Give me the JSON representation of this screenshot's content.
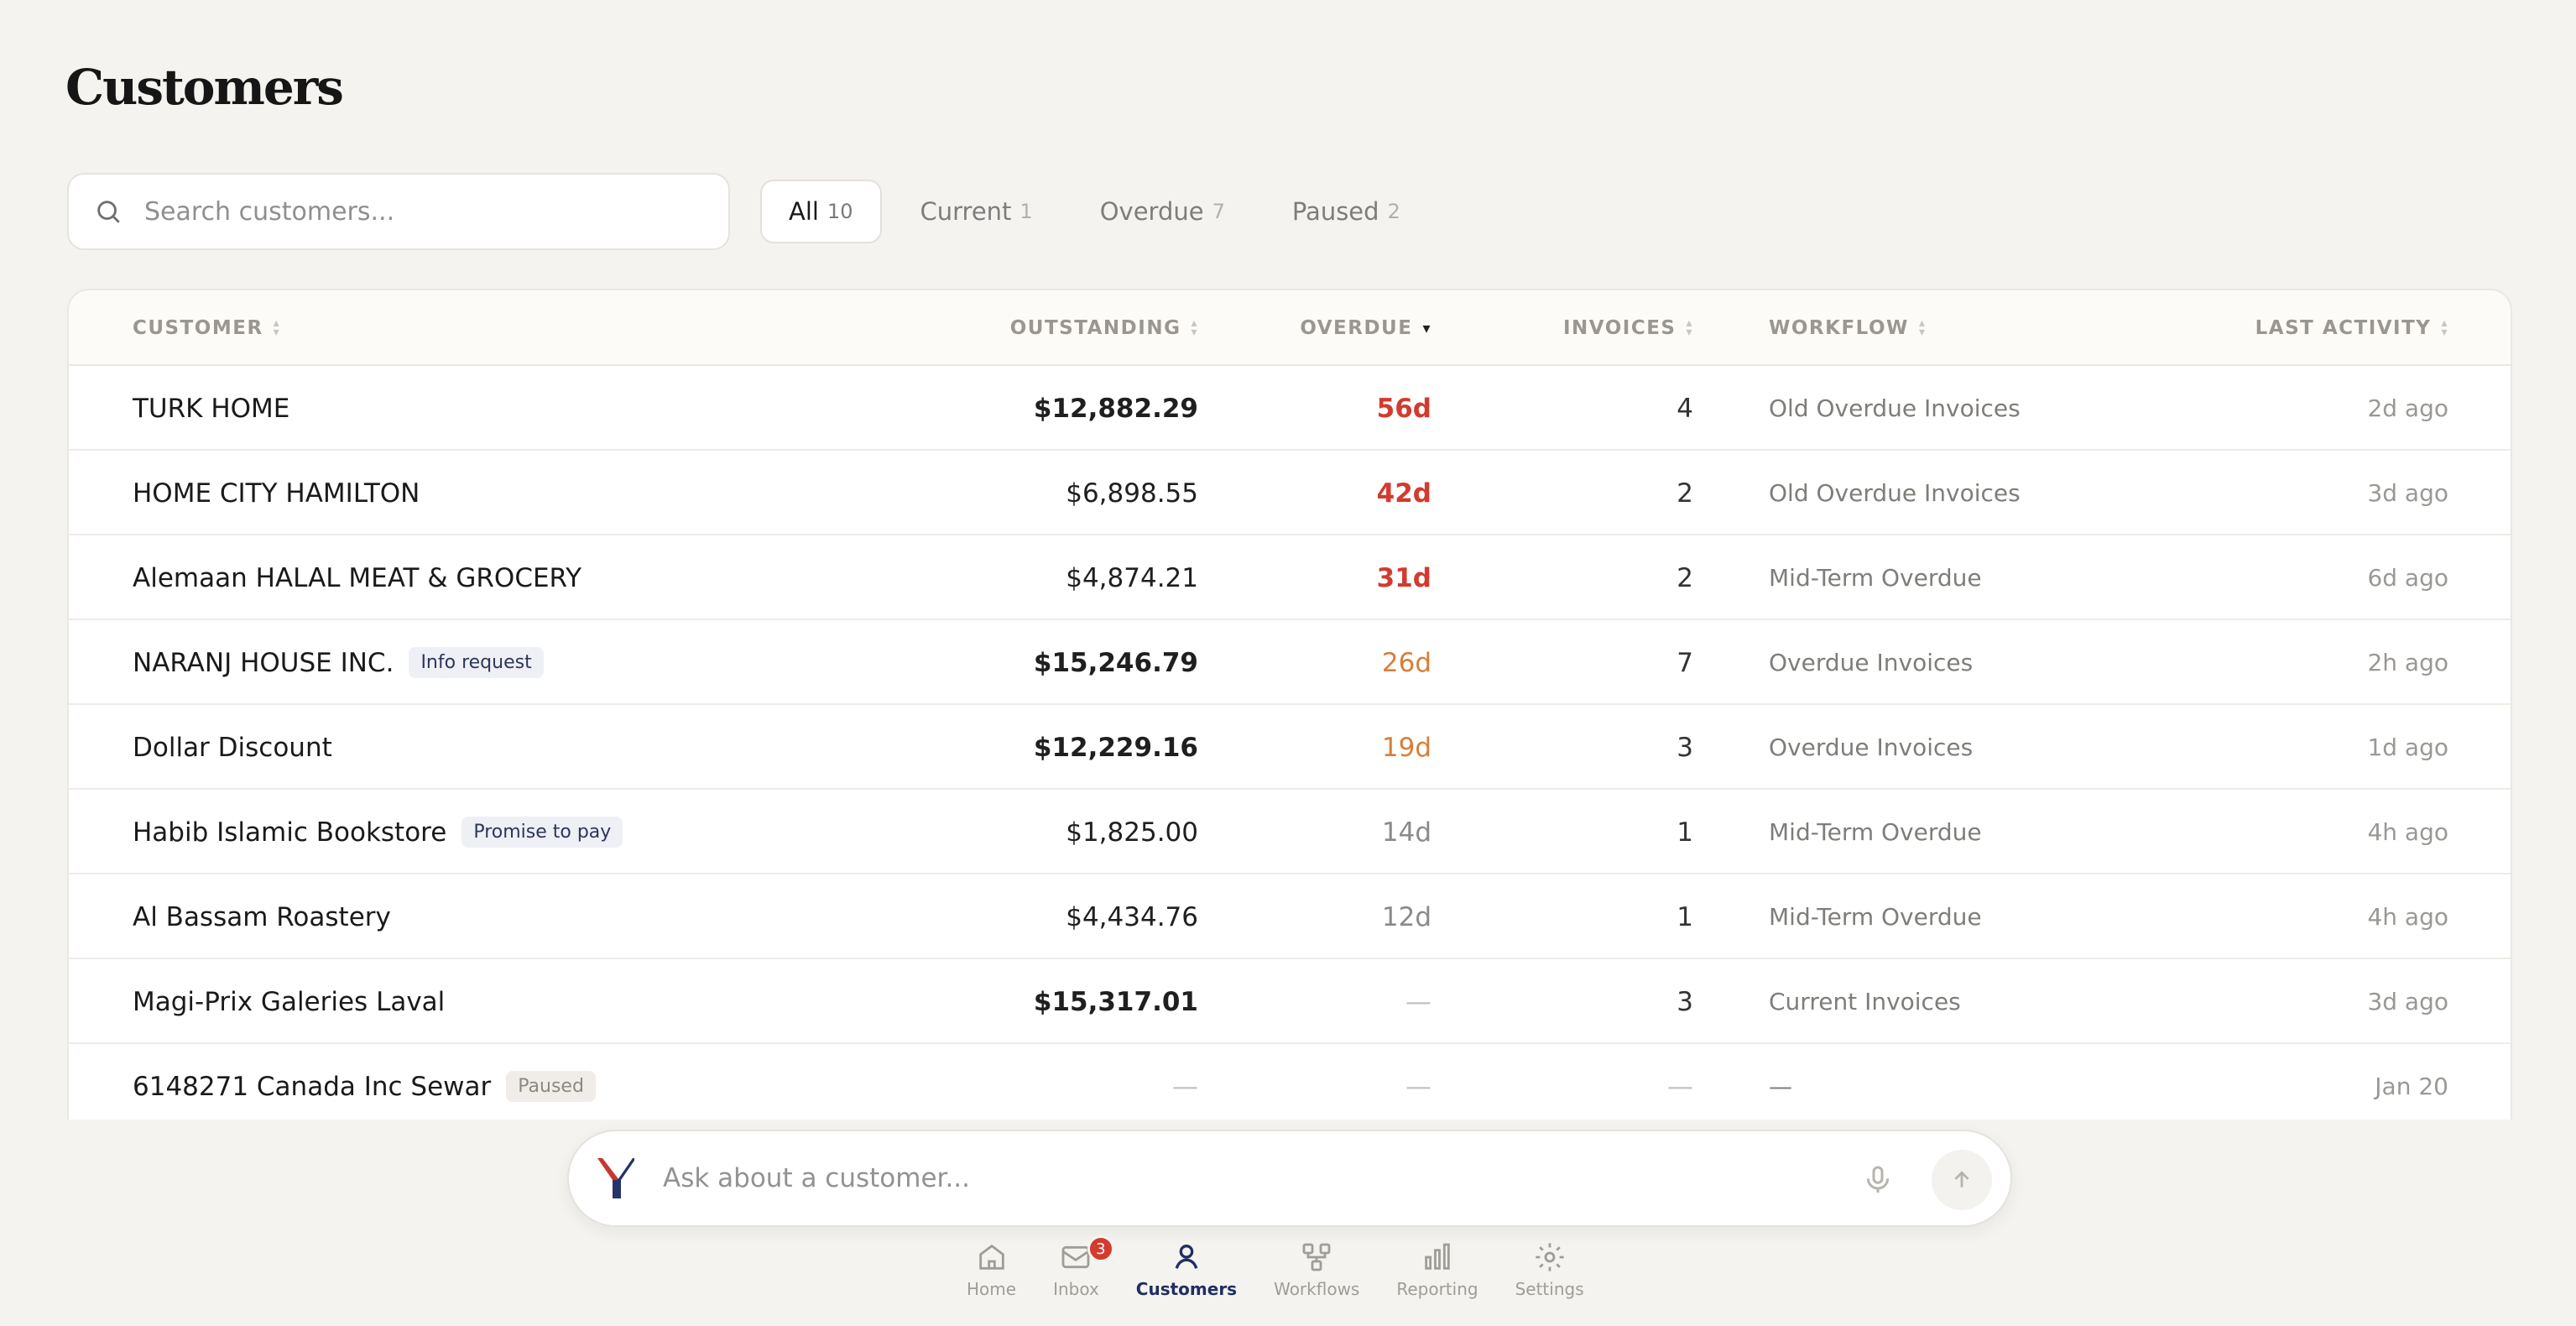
{
  "page": {
    "title": "Customers"
  },
  "search": {
    "placeholder": "Search customers..."
  },
  "filters": [
    {
      "label": "All",
      "count": "10"
    },
    {
      "label": "Current",
      "count": "1"
    },
    {
      "label": "Overdue",
      "count": "7"
    },
    {
      "label": "Paused",
      "count": "2"
    }
  ],
  "table": {
    "columns": [
      "CUSTOMER",
      "OUTSTANDING",
      "OVERDUE",
      "INVOICES",
      "WORKFLOW",
      "LAST ACTIVITY"
    ],
    "rows": [
      {
        "name": "TURK HOME",
        "outstanding": "$12,882.29",
        "overdue": "56d",
        "invoices": "4",
        "workflow": "Old Overdue Invoices",
        "last_activity": "2d ago"
      },
      {
        "name": "HOME CITY HAMILTON",
        "outstanding": "$6,898.55",
        "overdue": "42d",
        "invoices": "2",
        "workflow": "Old Overdue Invoices",
        "last_activity": "3d ago"
      },
      {
        "name": "Alemaan HALAL MEAT & GROCERY",
        "outstanding": "$4,874.21",
        "overdue": "31d",
        "invoices": "2",
        "workflow": "Mid-Term Overdue",
        "last_activity": "6d ago"
      },
      {
        "name": "NARANJ HOUSE INC.",
        "badge": "Info request",
        "outstanding": "$15,246.79",
        "overdue": "26d",
        "invoices": "7",
        "workflow": "Overdue Invoices",
        "last_activity": "2h ago"
      },
      {
        "name": "Dollar Discount",
        "outstanding": "$12,229.16",
        "overdue": "19d",
        "invoices": "3",
        "workflow": "Overdue Invoices",
        "last_activity": "1d ago"
      },
      {
        "name": "Habib Islamic Bookstore",
        "badge": "Promise to pay",
        "outstanding": "$1,825.00",
        "overdue": "14d",
        "invoices": "1",
        "workflow": "Mid-Term Overdue",
        "last_activity": "4h ago"
      },
      {
        "name": "Al Bassam Roastery",
        "outstanding": "$4,434.76",
        "overdue": "12d",
        "invoices": "1",
        "workflow": "Mid-Term Overdue",
        "last_activity": "4h ago"
      },
      {
        "name": "Magi-Prix Galeries Laval",
        "outstanding": "$15,317.01",
        "overdue": "—",
        "invoices": "3",
        "workflow": "Current Invoices",
        "last_activity": "3d ago"
      },
      {
        "name": "6148271 Canada Inc Sewar",
        "badge": "Paused",
        "outstanding": "—",
        "overdue": "—",
        "invoices": "—",
        "workflow": "—",
        "last_activity": "Jan 20"
      }
    ]
  },
  "assistant": {
    "placeholder": "Ask about a customer..."
  },
  "nav": [
    {
      "label": "Home",
      "icon": "home-icon"
    },
    {
      "label": "Inbox",
      "icon": "inbox-icon",
      "badge": "3"
    },
    {
      "label": "Customers",
      "icon": "person-icon"
    },
    {
      "label": "Workflows",
      "icon": "workflow-icon"
    },
    {
      "label": "Reporting",
      "icon": "bar-chart-icon"
    },
    {
      "label": "Settings",
      "icon": "gear-icon"
    }
  ],
  "colors": {
    "overdue_red": "#d23b2e",
    "overdue_orange": "#d67f3a",
    "nav_active": "#1f2f62",
    "badge_red": "#d33b2f"
  }
}
